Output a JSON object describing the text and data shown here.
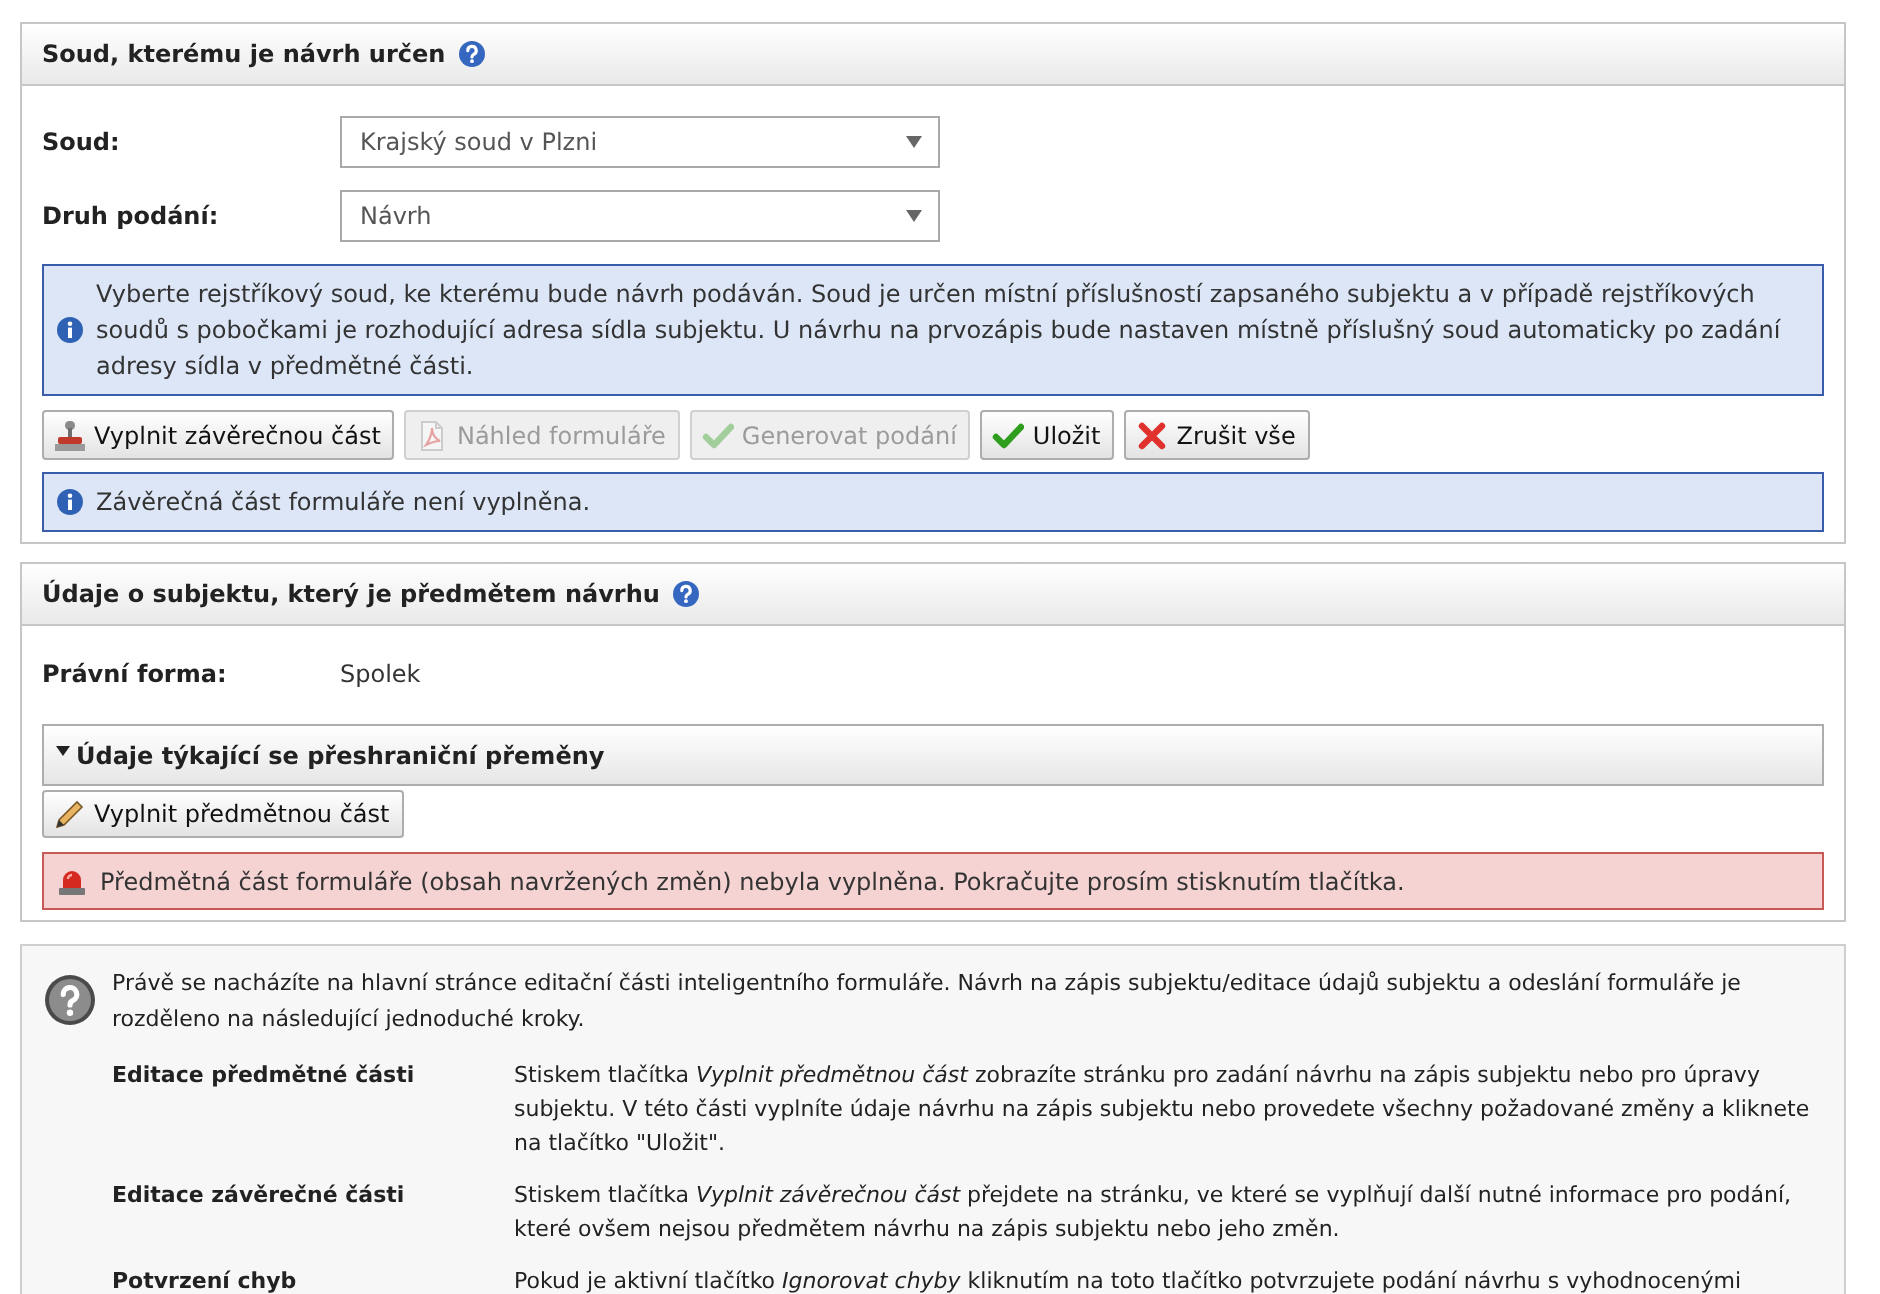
{
  "court_panel": {
    "title": "Soud, kterému je návrh určen",
    "fields": [
      {
        "kind": "select",
        "label": "Soud:",
        "value": "Krajský soud v Plzni"
      },
      {
        "kind": "select",
        "label": "Druh podání:",
        "value": "Návrh"
      }
    ],
    "notice": {
      "kind": "info",
      "text": "Vyberte rejstříkový soud, ke kterému bude návrh podáván. Soud je určen místní příslušností zapsaného subjektu a v případě rejstříkových soudů s pobočkami je rozhodující adresa sídla subjektu. U návrhu na prvozápis bude nastaven místně příslušný soud automaticky po zadání adresy sídla v předmětné části."
    },
    "buttons": [
      {
        "label": "Vyplnit závěrečnou část",
        "kind": "complete",
        "disabled": false
      },
      {
        "label": "Náhled formuláře",
        "kind": "preview",
        "disabled": true
      },
      {
        "label": "Generovat podání",
        "kind": "generate",
        "disabled": true
      },
      {
        "label": "Uložit",
        "kind": "save",
        "disabled": false
      },
      {
        "label": "Zrušit vše",
        "kind": "cancel",
        "disabled": false
      }
    ],
    "message": {
      "kind": "info",
      "text": "Závěrečná část formuláře není vyplněna."
    }
  },
  "subject_panel": {
    "title": "Údaje o subjektu, který je předmětem návrhu",
    "fields": [
      {
        "kind": "static",
        "label": "Právní forma:",
        "value": "Spolek"
      }
    ],
    "section": {
      "title": "Údaje týkající se přeshraniční přeměny",
      "expanded": true
    },
    "buttons": [
      {
        "label": "Vyplnit předmětnou část",
        "kind": "edit",
        "disabled": false
      }
    ],
    "message": {
      "kind": "error",
      "text": "Předmětná část formuláře (obsah navržených změn) nebyla vyplněna. Pokračujte prosím stisknutím tlačítka."
    }
  },
  "help_panel": {
    "intro": "Právě se nacházíte na hlavní stránce editační části inteligentního formuláře. Návrh na zápis subjektu/editace údajů subjektu a odeslání formuláře je rozděleno na následující jednoduché kroky.",
    "steps": [
      {
        "title": "Editace předmětné části",
        "text": "Stiskem tlačítka *Vyplnit předmětnou část* zobrazíte stránku pro zadání návrhu na zápis subjektu nebo pro úpravy subjektu. V této části vyplníte údaje návrhu na zápis subjektu nebo provedete všechny požadované změny a kliknete na tlačítko \"Uložit\"."
      },
      {
        "title": "Editace závěrečné části",
        "text": "Stiskem tlačítka *Vyplnit závěrečnou část* přejdete na stránku, ve které se vyplňují další nutné informace pro podání, které ovšem nejsou předmětem návrhu na zápis subjektu nebo jeho změn."
      },
      {
        "title": "Potvrzení chyb",
        "text": "Pokud je aktivní tlačítko *Ignorovat chyby* kliknutím na toto tlačítko potvrzujete podání návrhu s vyhodnocenými"
      }
    ]
  }
}
